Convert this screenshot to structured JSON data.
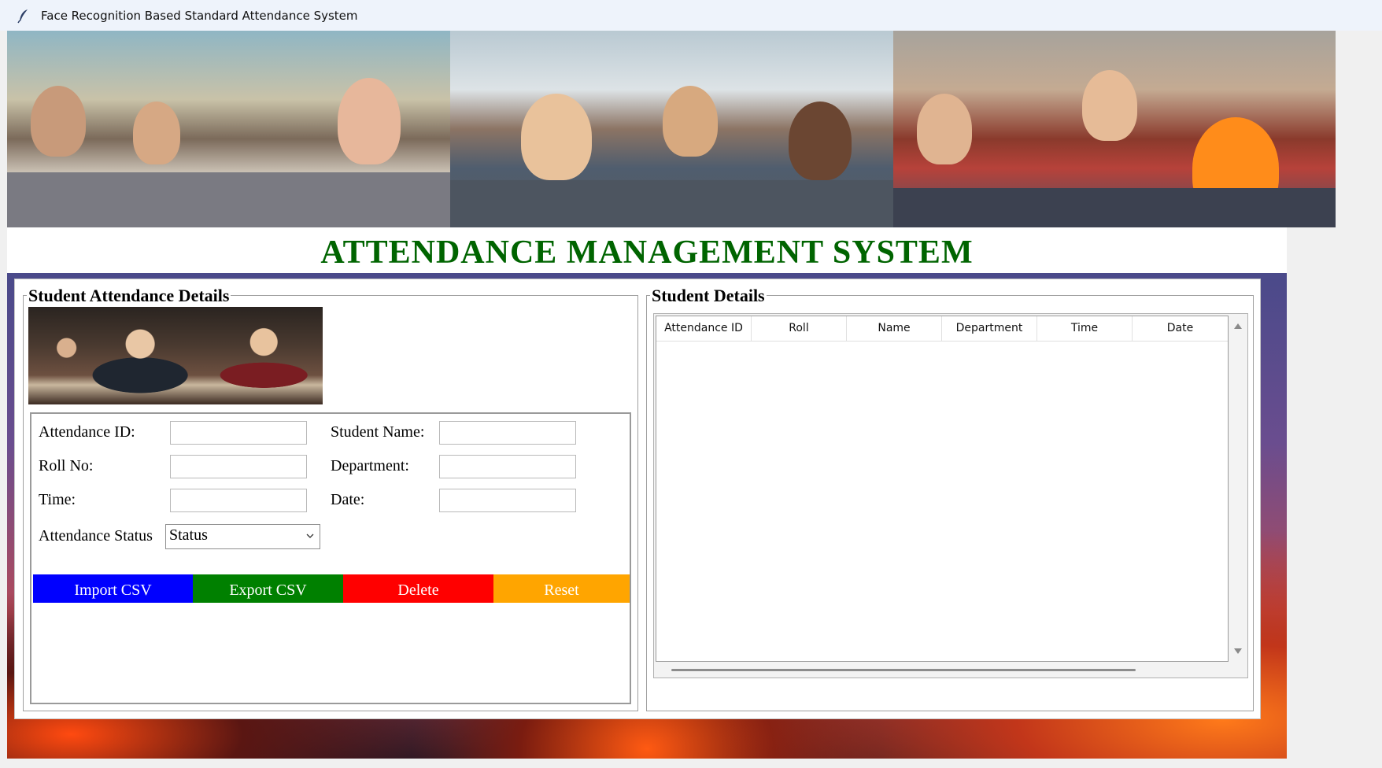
{
  "window": {
    "title": "Face Recognition Based Standard Attendance System",
    "icon": "feather-icon"
  },
  "header": {
    "title": "ATTENDANCE MANAGEMENT SYSTEM",
    "title_color": "#006400"
  },
  "left_panel": {
    "title": "Student Attendance Details",
    "fields": {
      "attendance_id_label": "Attendance ID:",
      "student_name_label": "Student Name:",
      "roll_no_label": "Roll No:",
      "department_label": "Department:",
      "time_label": "Time:",
      "date_label": "Date:",
      "attendance_status_label": "Attendance Status",
      "attendance_id_value": "",
      "student_name_value": "",
      "roll_no_value": "",
      "department_value": "",
      "time_value": "",
      "date_value": "",
      "status_selected": "Status"
    },
    "buttons": {
      "import": "Import CSV",
      "export": "Export CSV",
      "delete": "Delete",
      "reset": "Reset"
    },
    "button_colors": {
      "import": "#0000ff",
      "export": "#008000",
      "delete": "#ff0000",
      "reset": "#ffa500"
    }
  },
  "right_panel": {
    "title": "Student Details",
    "columns": [
      "Attendance ID",
      "Roll",
      "Name",
      "Department",
      "Time",
      "Date"
    ],
    "rows": []
  }
}
